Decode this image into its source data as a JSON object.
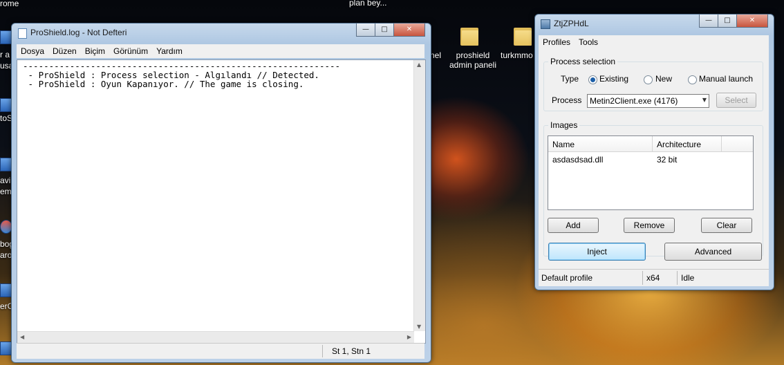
{
  "desktop": {
    "top_left_label": "rome",
    "top_center_label": "plan bey...",
    "icons": [
      {
        "label_line1": "nel",
        "label_line2": ""
      },
      {
        "label_line1": "proshield",
        "label_line2": "admin paneli"
      },
      {
        "label_line1": "turkmmo",
        "label_line2": ""
      }
    ],
    "left_edge_labels": [
      "r a",
      "usa",
      "toS",
      "avi",
      "emi",
      "bog",
      "aro",
      "erC"
    ]
  },
  "notepad": {
    "title": "ProShield.log - Not Defteri",
    "menu": [
      "Dosya",
      "Düzen",
      "Biçim",
      "Görünüm",
      "Yardım"
    ],
    "content": "-------------------------------------------------------------\n - ProShield : Process selection - Algılandı // Detected.\n - ProShield : Oyun Kapanıyor. // The game is closing.",
    "status_position": "St 1, Stn 1"
  },
  "injector": {
    "title": "ZtjZPHdL",
    "menu": [
      "Profiles",
      "Tools"
    ],
    "process_selection": {
      "group_title": "Process selection",
      "type_label": "Type",
      "options": [
        "Existing",
        "New",
        "Manual launch"
      ],
      "selected_option": "Existing",
      "process_label": "Process",
      "process_value": "Metin2Client.exe (4176)",
      "select_button": "Select"
    },
    "images": {
      "group_title": "Images",
      "columns": [
        "Name",
        "Architecture"
      ],
      "rows": [
        {
          "name": "asdasdsad.dll",
          "architecture": "32 bit"
        }
      ],
      "buttons": {
        "add": "Add",
        "remove": "Remove",
        "clear": "Clear"
      }
    },
    "inject_button": "Inject",
    "advanced_button": "Advanced",
    "status": {
      "profile": "Default profile",
      "arch": "x64",
      "state": "Idle"
    }
  }
}
